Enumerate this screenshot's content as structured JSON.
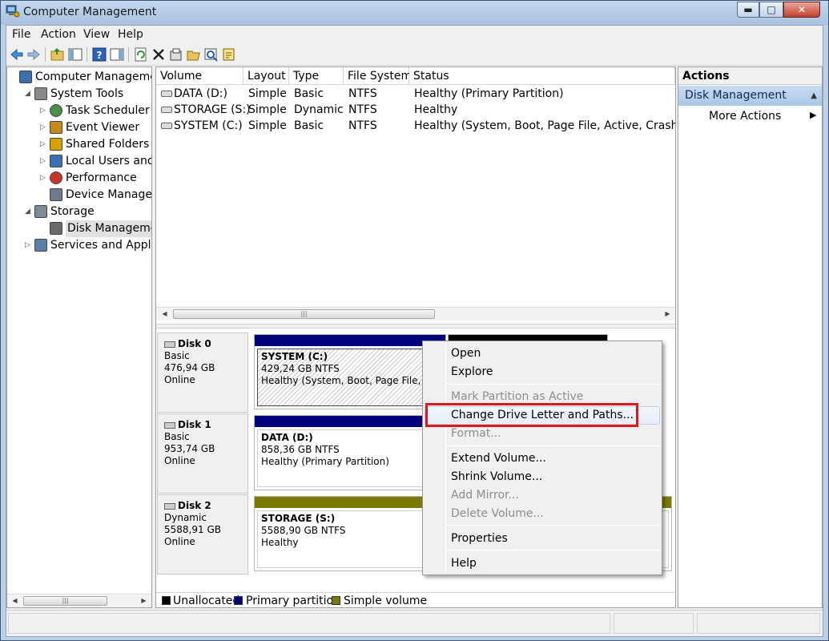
{
  "window": {
    "title": "Computer Management",
    "controls": {
      "minimize": "▬",
      "maximize": "□",
      "close": "✕"
    }
  },
  "menubar": [
    "File",
    "Action",
    "View",
    "Help"
  ],
  "toolbar": {
    "icons": [
      "back-arrow-icon",
      "forward-arrow-icon",
      "up-folder-icon",
      "show-hide-tree-icon",
      "help-icon",
      "show-hide-action-pane-icon",
      "refresh-icon",
      "delete-icon",
      "properties-icon",
      "open-folder-icon",
      "search-icon",
      "export-icon"
    ]
  },
  "tree": {
    "items": [
      {
        "label": "Computer Management",
        "indent": 0,
        "arrow": ""
      },
      {
        "label": "System Tools",
        "indent": 1,
        "arrow": "◢"
      },
      {
        "label": "Task Scheduler",
        "indent": 2,
        "arrow": "▷"
      },
      {
        "label": "Event Viewer",
        "indent": 2,
        "arrow": "▷"
      },
      {
        "label": "Shared Folders",
        "indent": 2,
        "arrow": "▷"
      },
      {
        "label": "Local Users and Gr",
        "indent": 2,
        "arrow": "▷"
      },
      {
        "label": "Performance",
        "indent": 2,
        "arrow": "▷"
      },
      {
        "label": "Device Manager",
        "indent": 2,
        "arrow": ""
      },
      {
        "label": "Storage",
        "indent": 1,
        "arrow": "◢"
      },
      {
        "label": "Disk Management",
        "indent": 2,
        "arrow": ""
      },
      {
        "label": "Services and Applicat",
        "indent": 1,
        "arrow": "▷"
      }
    ],
    "selected": "Disk Management"
  },
  "volumes": {
    "columns": [
      "Volume",
      "Layout",
      "Type",
      "File System",
      "Status"
    ],
    "rows": [
      [
        "DATA (D:)",
        "Simple",
        "Basic",
        "NTFS",
        "Healthy (Primary Partition)"
      ],
      [
        "STORAGE (S:)",
        "Simple",
        "Dynamic",
        "NTFS",
        "Healthy"
      ],
      [
        "SYSTEM (C:)",
        "Simple",
        "Basic",
        "NTFS",
        "Healthy (System, Boot, Page File, Active, Crash Dum"
      ]
    ]
  },
  "disks": [
    {
      "name": "Disk 0",
      "type": "Basic",
      "size": "476,94 GB",
      "state": "Online",
      "partition": {
        "name": "SYSTEM  (C:)",
        "size": "429,24 GB NTFS",
        "status": "Healthy (System, Boot, Page File, Activ"
      }
    },
    {
      "name": "Disk 1",
      "type": "Basic",
      "size": "953,74 GB",
      "state": "Online",
      "partition": {
        "name": "DATA  (D:)",
        "size": "858,36 GB NTFS",
        "status": "Healthy (Primary Partition)"
      }
    },
    {
      "name": "Disk 2",
      "type": "Dynamic",
      "size": "5588,91 GB",
      "state": "Online",
      "partition": {
        "name": "STORAGE  (S:)",
        "size": "5588,90 GB NTFS",
        "status": "Healthy"
      }
    }
  ],
  "legend": [
    {
      "label": "Unallocated",
      "color": "#000000"
    },
    {
      "label": "Primary partition",
      "color": "#00007a"
    },
    {
      "label": "Simple volume",
      "color": "#7a7a00"
    }
  ],
  "actions": {
    "header": "Actions",
    "section": "Disk Management",
    "item": "More Actions"
  },
  "context_menu": {
    "items": [
      {
        "label": "Open",
        "disabled": false
      },
      {
        "label": "Explore",
        "disabled": false
      },
      {
        "label": "Mark Partition as Active",
        "disabled": true
      },
      {
        "label": "Change Drive Letter and Paths...",
        "disabled": false
      },
      {
        "label": "Format...",
        "disabled": true
      },
      {
        "label": "Extend Volume...",
        "disabled": false
      },
      {
        "label": "Shrink Volume...",
        "disabled": false
      },
      {
        "label": "Add Mirror...",
        "disabled": true
      },
      {
        "label": "Delete Volume...",
        "disabled": true
      },
      {
        "label": "Properties",
        "disabled": false
      },
      {
        "label": "Help",
        "disabled": false
      }
    ]
  },
  "colors": {
    "primary_partition": "#00007a",
    "simple_volume": "#7a7a00",
    "unallocated": "#000000",
    "highlight_box": "#e0161d"
  }
}
